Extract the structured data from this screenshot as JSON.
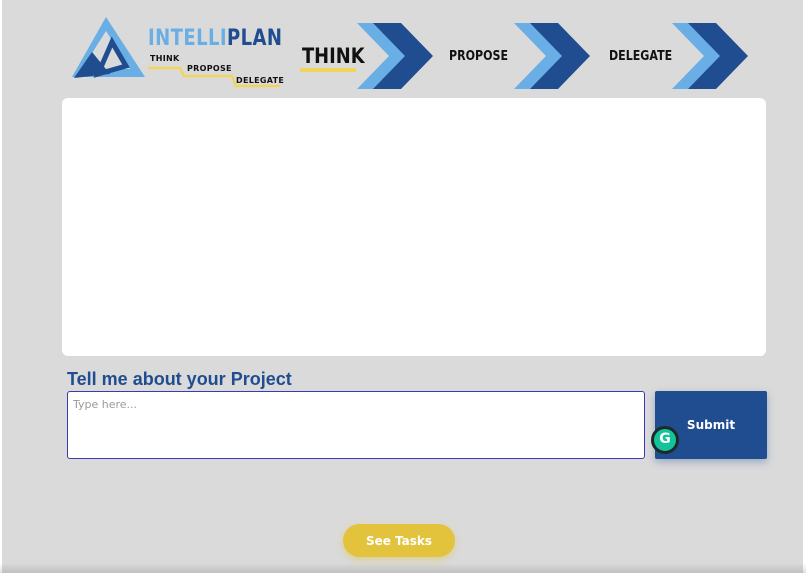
{
  "brand": {
    "name_part1": "INTELLI",
    "name_part2": "PLAN",
    "tagline_think": "THINK",
    "tagline_propose": "PROPOSE",
    "tagline_delegate": "DELEGATE"
  },
  "steps": [
    {
      "label": "THINK",
      "active": true
    },
    {
      "label": "PROPOSE",
      "active": false
    },
    {
      "label": "DELEGATE",
      "active": false
    }
  ],
  "prompt": {
    "label": "Tell me about your Project",
    "placeholder": "Type here...",
    "value": "",
    "submit_label": "Submit"
  },
  "actions": {
    "see_tasks_label": "See Tasks"
  },
  "icons": {
    "logo": "intelliplan-triangle-logo",
    "chevron": "chevron-right-icon",
    "grammarly": "grammarly-icon"
  },
  "colors": {
    "brand_dark": "#1f4d8f",
    "brand_light": "#6aaee6",
    "accent_yellow": "#e2c33b",
    "background": "#dadada"
  }
}
